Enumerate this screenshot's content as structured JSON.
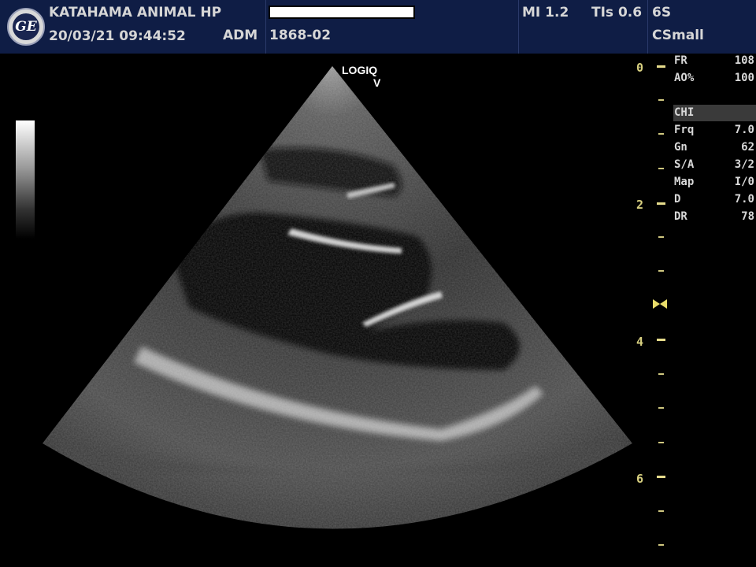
{
  "header": {
    "hospital": "KATAHAMA ANIMAL HP",
    "datetime": "20/03/21 09:44:52",
    "operator": "ADM",
    "patient_id": "1868-02",
    "mi": "MI 1.2",
    "tis": "TIs 0.6",
    "probe": "6S",
    "preset": "CSmall",
    "logo_text": "GE"
  },
  "probe_label": {
    "line1": "LOGIQ",
    "line2": "V"
  },
  "depth_scale": {
    "labels": [
      "0",
      "2",
      "4",
      "6"
    ],
    "focus_marker": "focus-icon"
  },
  "params_top": [
    {
      "key": "FR",
      "value": "108"
    },
    {
      "key": "AO%",
      "value": "100"
    }
  ],
  "mode_label": "CHI",
  "params": [
    {
      "key": "Frq",
      "value": "7.0"
    },
    {
      "key": "Gn",
      "value": "62"
    },
    {
      "key": "S/A",
      "value": "3/2"
    },
    {
      "key": "Map",
      "value": "I/0"
    },
    {
      "key": "D",
      "value": "7.0"
    },
    {
      "key": "DR",
      "value": "78"
    }
  ],
  "colors": {
    "header_bg": "#0f1d45",
    "depth_color": "#d8d080",
    "text": "#d6d6d6"
  }
}
